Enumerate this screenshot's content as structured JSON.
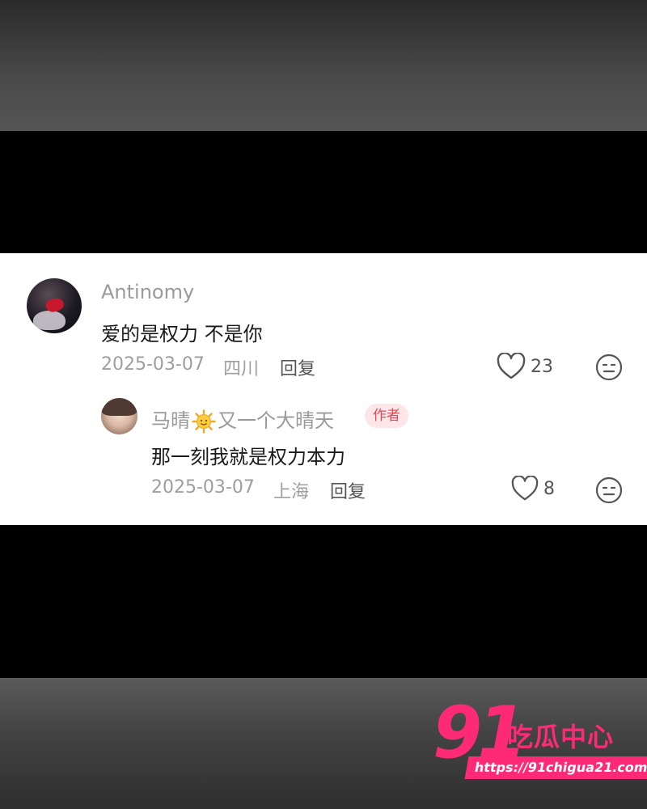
{
  "comments": [
    {
      "username": "Antinomy",
      "text": "爱的是权力 不是你",
      "date": "2025-03-07",
      "location": "四川",
      "reply_label": "回复",
      "likes": "23"
    }
  ],
  "reply": {
    "username_part1": "马晴",
    "username_part2": "又一个大晴天",
    "author_badge": "作者",
    "text": "那一刻我就是权力本力",
    "date": "2025-03-07",
    "location": "上海",
    "reply_label": "回复",
    "likes": "8"
  },
  "watermark": {
    "number": "91",
    "brand": "吃瓜中心",
    "url": "https://91chigua21.com"
  },
  "icons": {
    "like": "heart-icon",
    "emoji": "neutral-face-icon",
    "username_emoji": "sun-emoji-icon"
  },
  "colors": {
    "accent": "#ff2a75",
    "badge_bg": "#fde6e8",
    "badge_text": "#e04a5a"
  }
}
